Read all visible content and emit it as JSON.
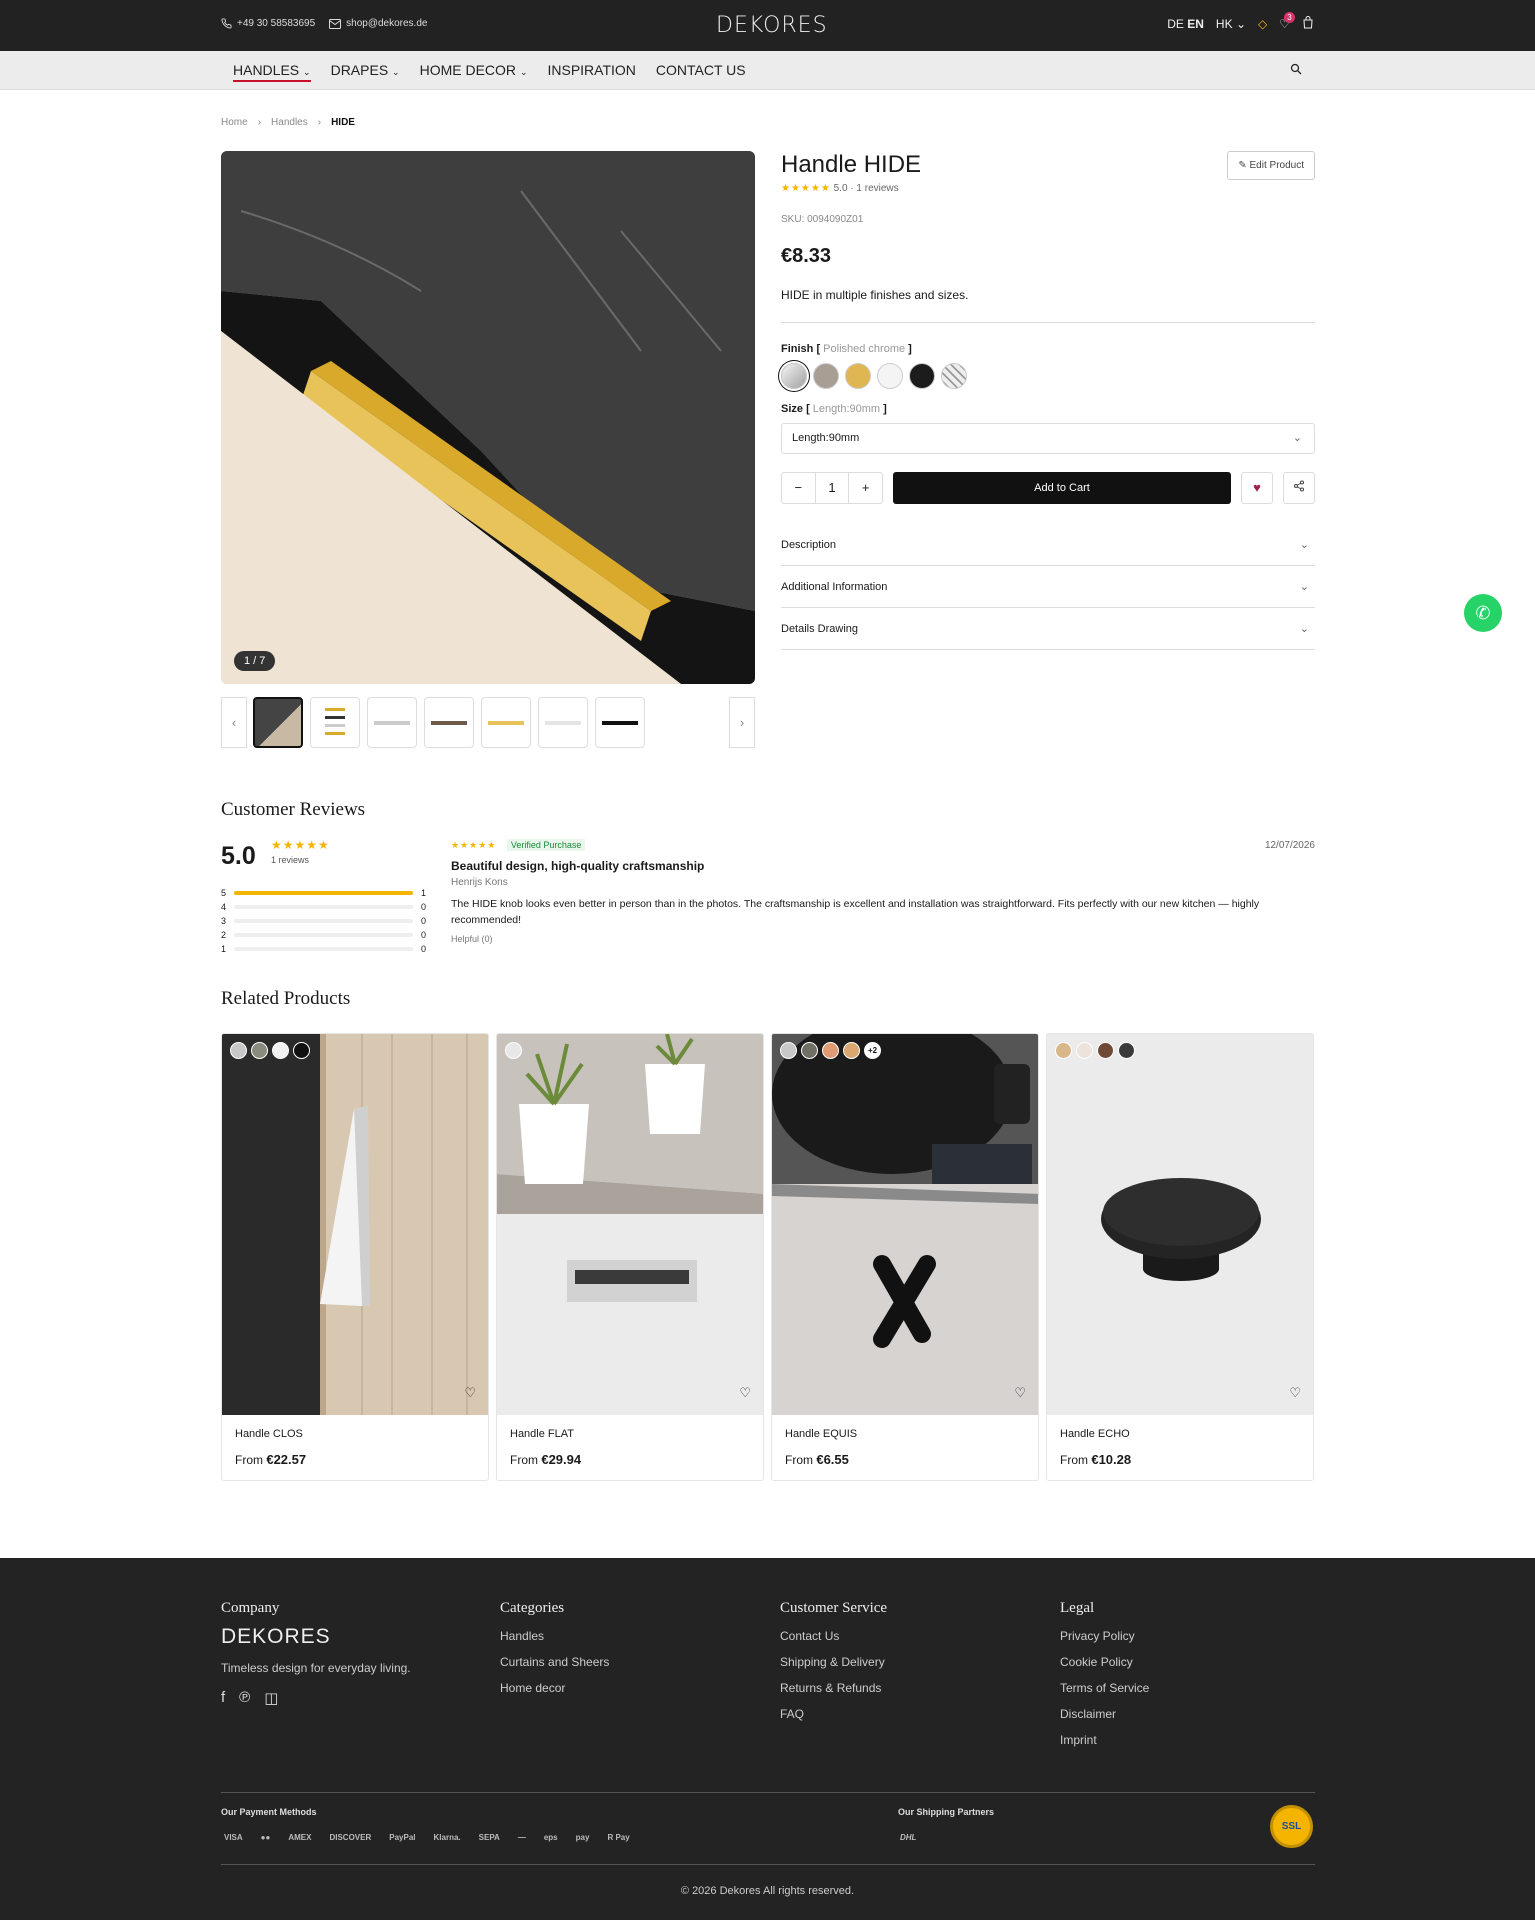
{
  "topbar": {
    "phone": "+49 30 58583695",
    "email": "shop@dekores.de",
    "logo": "DEKORES",
    "lang_de": "DE",
    "lang_en": "EN",
    "currency": "HK",
    "wishlist_count": "3"
  },
  "nav": {
    "items": [
      "HANDLES",
      "DRAPES",
      "HOME DECOR",
      "INSPIRATION",
      "CONTACT US"
    ]
  },
  "breadcrumb": [
    "Home",
    "Handles",
    "HIDE"
  ],
  "gallery": {
    "counter": "1 / 7"
  },
  "product": {
    "title": "Handle HIDE",
    "rating": "5.0",
    "reviews": "1 reviews",
    "edit_label": "Edit Product",
    "sku": "SKU: 0094090Z01",
    "price": "€8.33",
    "short_desc": "HIDE in multiple finishes and sizes.",
    "finish_label": "Finish",
    "finish_value": "Polished chrome",
    "swatch_colors": [
      "#d9d9d9",
      "#a89e94",
      "#e0b652",
      "#f4f4f4",
      "#1c1c1c",
      "#e8e8e8"
    ],
    "size_label": "Size",
    "size_value": "Length:90mm",
    "size_select": "Length:90mm",
    "qty": "1",
    "add_to_cart": "Add to Cart",
    "accordion": [
      "Description",
      "Additional Information",
      "Details Drawing"
    ]
  },
  "reviews": {
    "heading": "Customer Reviews",
    "score": "5.0",
    "count": "1 reviews",
    "bars": [
      {
        "star": "5",
        "count": "1",
        "fill": 1
      },
      {
        "star": "4",
        "count": "0",
        "fill": 0
      },
      {
        "star": "3",
        "count": "0",
        "fill": 0
      },
      {
        "star": "2",
        "count": "0",
        "fill": 0
      },
      {
        "star": "1",
        "count": "0",
        "fill": 0
      }
    ],
    "item": {
      "verified": "Verified Purchase",
      "date": "12/07/2026",
      "title": "Beautiful design, high-quality craftsmanship",
      "author": "Henrijs Kons",
      "body": "The HIDE knob looks even better in person than in the photos. The craftsmanship is excellent and installation was straightforward. Fits perfectly with our new kitchen — highly recommended!",
      "helpful": "Helpful (0)"
    }
  },
  "related": {
    "heading": "Related Products",
    "products": [
      {
        "name": "Handle CLOS",
        "from": "From",
        "price": "€22.57",
        "swatches": [
          "#c8c8c8",
          "#8a8a7e",
          "#f2f2f2",
          "#111111"
        ]
      },
      {
        "name": "Handle FLAT",
        "from": "From",
        "price": "€29.94",
        "swatches": [
          "#e8e8e8"
        ]
      },
      {
        "name": "Handle EQUIS",
        "from": "From",
        "price": "€6.55",
        "swatches": [
          "#c8c8c8",
          "#6f6f66",
          "#e09a74",
          "#d8a870"
        ],
        "more": "+2"
      },
      {
        "name": "Handle ECHO",
        "from": "From",
        "price": "€10.28",
        "swatches": [
          "#d9b78b",
          "#ece4dc",
          "#6e4a35",
          "#3a3a3a"
        ]
      }
    ]
  },
  "footer": {
    "company_heading": "Company",
    "logo": "DEKORES",
    "tagline": "Timeless design for everyday living.",
    "categories_heading": "Categories",
    "categories": [
      "Handles",
      "Curtains and Sheers",
      "Home decor"
    ],
    "service_heading": "Customer Service",
    "service": [
      "Contact Us",
      "Shipping & Delivery",
      "Returns & Refunds",
      "FAQ"
    ],
    "legal_heading": "Legal",
    "legal": [
      "Privacy Policy",
      "Cookie Policy",
      "Terms of Service",
      "Disclaimer",
      "Imprint"
    ],
    "payment_heading": "Our Payment Methods",
    "payment_logos": [
      "VISA",
      "●●",
      "AMEX",
      "DISCOVER",
      "PayPal",
      "Klarna.",
      "SEPA",
      "—",
      "eps",
      "pay",
      "R Pay"
    ],
    "shipping_heading": "Our Shipping Partners",
    "shipping_logo": "DHL",
    "ssl": "SSL",
    "copyright": "© 2026 Dekores All rights reserved."
  }
}
